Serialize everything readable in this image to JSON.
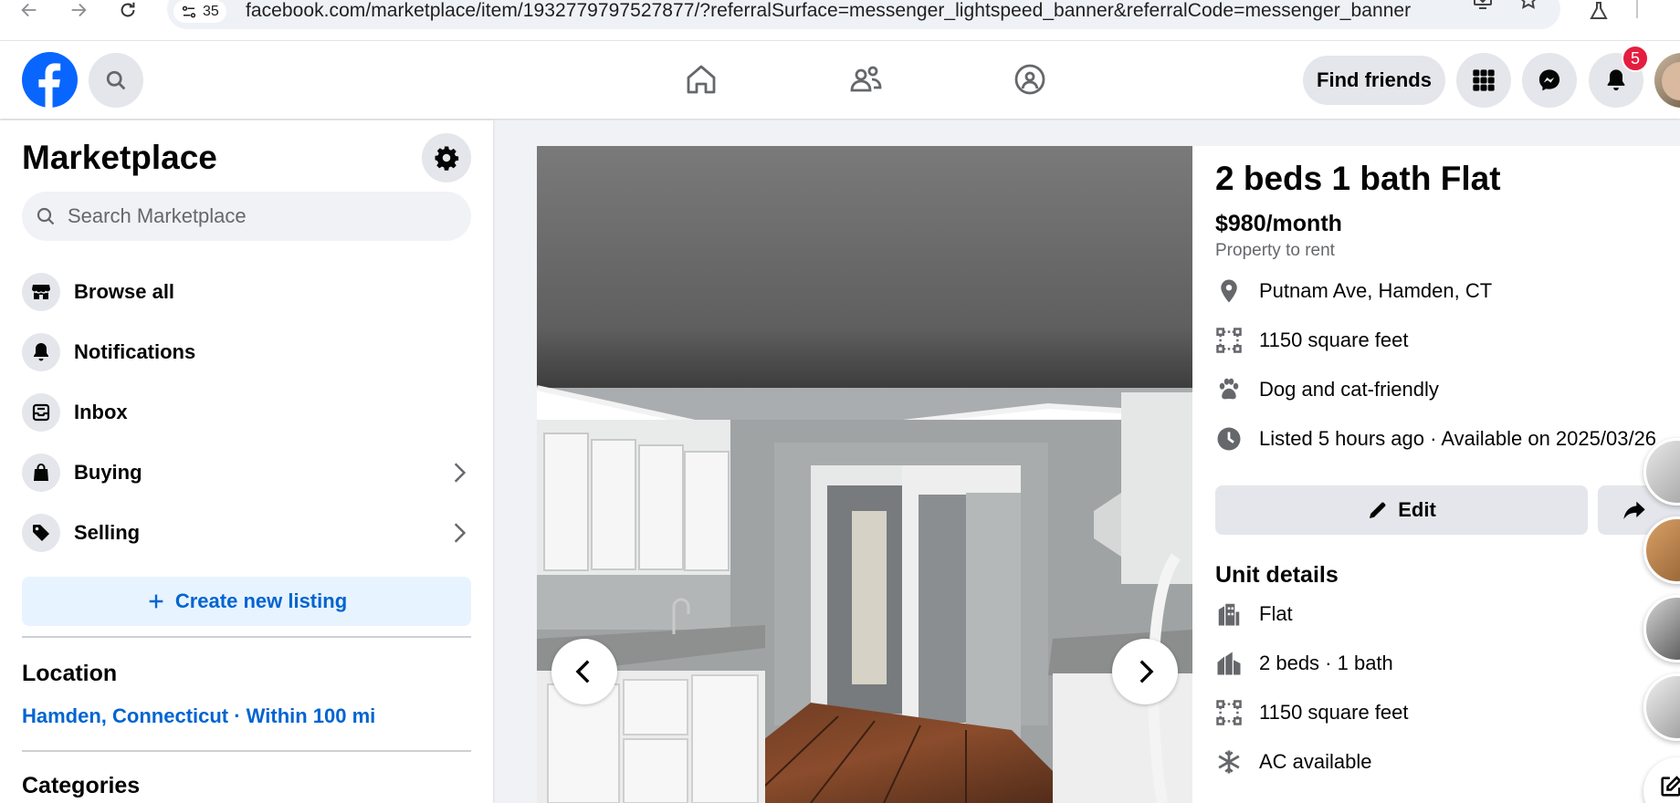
{
  "browser": {
    "tab_count": "35",
    "url": "facebook.com/marketplace/item/1932779797527877/?referralSurface=messenger_lightspeed_banner&referralCode=messenger_banner",
    "icons": [
      "back-arrow-icon",
      "forward-arrow-icon",
      "reload-icon",
      "site-settings-icon",
      "install-app-icon",
      "bookmark-star-icon",
      "labs-flask-icon"
    ]
  },
  "header": {
    "find_friends_label": "Find friends",
    "notification_count": "5",
    "icons": [
      "facebook-logo-icon",
      "search-icon",
      "home-icon",
      "friends-icon",
      "groups-icon",
      "menu-grid-icon",
      "messenger-icon",
      "bell-icon"
    ]
  },
  "sidebar": {
    "title": "Marketplace",
    "search_placeholder": "Search Marketplace",
    "items": [
      {
        "label": "Browse all",
        "icon": "storefront-icon"
      },
      {
        "label": "Notifications",
        "icon": "bell-icon"
      },
      {
        "label": "Inbox",
        "icon": "inbox-icon"
      },
      {
        "label": "Buying",
        "icon": "shopping-bag-icon"
      },
      {
        "label": "Selling",
        "icon": "price-tag-icon"
      }
    ],
    "create_listing_label": "Create new listing",
    "location_title": "Location",
    "location_value": "Hamden, Connecticut · Within 100 mi",
    "categories_title": "Categories"
  },
  "listing": {
    "title": "2 beds 1 bath Flat",
    "price": "$980/month",
    "property_type": "Property to rent",
    "info": [
      {
        "text": "Putnam Ave, Hamden, CT",
        "icon": "location-pin-icon"
      },
      {
        "text": "1150 square feet",
        "icon": "area-icon"
      },
      {
        "text": "Dog and cat-friendly",
        "icon": "paw-icon"
      },
      {
        "text": "Listed 5 hours ago · Available on 2025/03/26",
        "icon": "clock-icon"
      }
    ],
    "edit_label": "Edit",
    "unit_details_title": "Unit details",
    "unit_details": [
      {
        "text": "Flat",
        "icon": "building-icon"
      },
      {
        "text": "2 beds · 1 bath",
        "icon": "house-icon"
      },
      {
        "text": "1150 square feet",
        "icon": "area-icon"
      },
      {
        "text": "AC available",
        "icon": "snowflake-icon"
      }
    ]
  },
  "colors": {
    "facebook_blue": "#0866ff",
    "link_blue": "#0064d1",
    "badge_red": "#e41e3f",
    "secondary_gray": "#e4e6eb",
    "page_bg": "#f0f2f5"
  }
}
